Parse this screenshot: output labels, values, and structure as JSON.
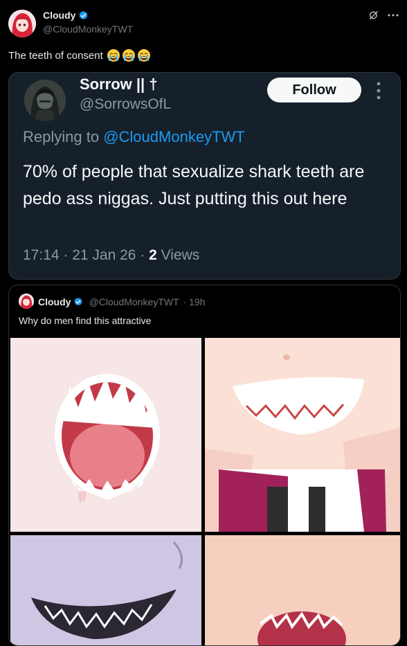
{
  "post": {
    "author_name": "Cloudy",
    "author_handle": "@CloudMonkeyTWT",
    "text": "The teeth of consent",
    "emoji_icons": [
      "crying-face-icon",
      "crying-face-icon",
      "crying-face-icon"
    ]
  },
  "screenshot_card": {
    "author_name": "Sorrow || †",
    "author_handle": "@SorrowsOfL",
    "follow_label": "Follow",
    "replying_prefix": "Replying to",
    "replying_to": "@CloudMonkeyTWT",
    "body": "70% of people that sexualize shark teeth are pedo ass niggas. Just putting this out here",
    "time_date": "17:14 · 21 Jan 26 ·",
    "views_count": "2",
    "views_label": "Views"
  },
  "quoted_post": {
    "author_name": "Cloudy",
    "author_handle": "@CloudMonkeyTWT",
    "age": "· 19h",
    "text": "Why do men find this attractive"
  },
  "colors": {
    "background": "#000000",
    "card_background": "#15202b",
    "accent": "#1d9bf0",
    "secondary_text": "#71767b"
  }
}
